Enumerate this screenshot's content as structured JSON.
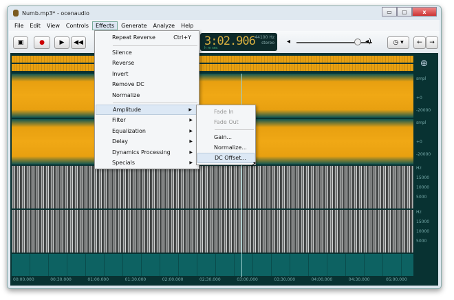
{
  "window": {
    "title": "Numb.mp3* - ocenaudio",
    "min": "▭",
    "max": "▢",
    "close": "x"
  },
  "menubar": [
    "File",
    "Edit",
    "View",
    "Controls",
    "Effects",
    "Generate",
    "Analyze",
    "Help"
  ],
  "toolbar": {
    "time": "3:02.906",
    "sample_rate": "44100 Hz",
    "channels": "stereo",
    "unit": "h m sec",
    "volume": 0.83
  },
  "effects_menu": {
    "items": [
      {
        "label": "Repeat Reverse",
        "shortcut": "Ctrl+Y"
      },
      {
        "label": "Silence"
      },
      {
        "label": "Reverse"
      },
      {
        "label": "Invert"
      },
      {
        "label": "Remove DC"
      },
      {
        "label": "Normalize"
      },
      {
        "label": "Amplitude"
      },
      {
        "label": "Filter"
      },
      {
        "label": "Equalization"
      },
      {
        "label": "Delay"
      },
      {
        "label": "Dynamics Processing"
      },
      {
        "label": "Specials"
      }
    ]
  },
  "amplitude_submenu": [
    "Fade In",
    "Fade Out",
    "Gain...",
    "Normalize...",
    "DC Offset..."
  ],
  "axis": {
    "unit_wave": "smpl",
    "zero": "+0",
    "neg": "-20000",
    "unit_spec": "Hz",
    "f1": "15000",
    "f2": "10000",
    "f3": "5000"
  },
  "timeline": [
    "00:00.000",
    "00:30.000",
    "01:00.000",
    "01:30.000",
    "02:00.000",
    "02:30.000",
    "03:00.000",
    "03:30.000",
    "04:00.000",
    "04:30.000",
    "05:00.000"
  ],
  "colors": {
    "waveform": "#f0a815",
    "background": "#083232",
    "timeline": "#0d6262"
  }
}
